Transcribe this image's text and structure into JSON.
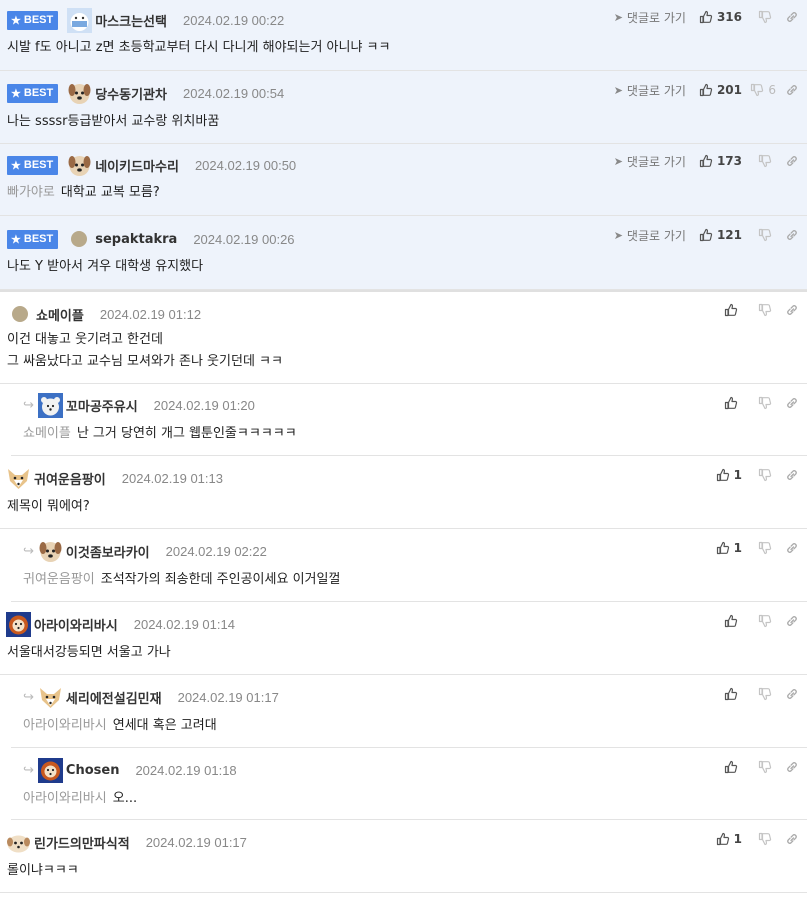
{
  "labels": {
    "best": "BEST",
    "goto": "댓글로 가기"
  },
  "colors": {
    "best_badge": "#4a86e8",
    "best_bg": "#eef3fb"
  },
  "best_comments": [
    {
      "nick": "마스크는선택",
      "date": "2024.02.19 00:22",
      "likes": "316",
      "dislikes": "",
      "text": "시발 f도 아니고 z면 초등학교부터 다시 다니게 해야되는거 아니냐 ㅋㅋ",
      "quote": ""
    },
    {
      "nick": "당수동기관차",
      "date": "2024.02.19 00:54",
      "likes": "201",
      "dislikes": "6",
      "text": "나는 ssssr등급받아서 교수랑 위치바꿈",
      "quote": ""
    },
    {
      "nick": "네이키드마수리",
      "date": "2024.02.19 00:50",
      "likes": "173",
      "dislikes": "",
      "text": "대학교 교복 모름?",
      "quote": "빠가야로"
    },
    {
      "nick": "sepaktakra",
      "date": "2024.02.19 00:26",
      "likes": "121",
      "dislikes": "",
      "text": "나도 Y 받아서 겨우 대학생 유지했다",
      "quote": ""
    }
  ],
  "comments": [
    {
      "nick": "쇼메이플",
      "date": "2024.02.19 01:12",
      "likes": "",
      "text": "이건 대놓고 웃기려고 한건데\n그 싸움났다고 교수님 모셔와가 존나 웃기던데 ㅋㅋ",
      "quote": ""
    },
    {
      "nick": "꼬마공주유시",
      "date": "2024.02.19 01:20",
      "likes": "",
      "text": "난 그거 당연히 개그 웹툰인줄ㅋㅋㅋㅋㅋ",
      "quote": "쇼메이플"
    },
    {
      "nick": "귀여운음팡이",
      "date": "2024.02.19 01:13",
      "likes": "1",
      "text": "제목이 뭐에여?",
      "quote": ""
    },
    {
      "nick": "이것좀보라카이",
      "date": "2024.02.19 02:22",
      "likes": "1",
      "text": "조석작가의 죄송한데 주인공이세요 이거일껄",
      "quote": "귀여운음팡이"
    },
    {
      "nick": "아라이와리바시",
      "date": "2024.02.19 01:14",
      "likes": "",
      "text": "서울대서강등되면 서울고 가나",
      "quote": ""
    },
    {
      "nick": "세리에전설김민재",
      "date": "2024.02.19 01:17",
      "likes": "",
      "text": "연세대 혹은 고려대",
      "quote": "아라이와리바시"
    },
    {
      "nick": "Chosen",
      "date": "2024.02.19 01:18",
      "likes": "",
      "text": "오...",
      "quote": "아라이와리바시"
    },
    {
      "nick": "린가드의만파식적",
      "date": "2024.02.19 01:17",
      "likes": "1",
      "text": "롤이냐ㅋㅋㅋ",
      "quote": ""
    }
  ]
}
